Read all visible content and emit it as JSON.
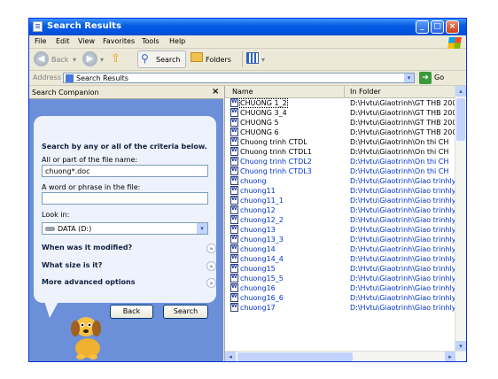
{
  "window": {
    "title": "Search Results"
  },
  "menu": [
    "File",
    "Edit",
    "View",
    "Favorites",
    "Tools",
    "Help"
  ],
  "toolbar": {
    "back_label": "Back",
    "search_label": "Search",
    "folders_label": "Folders"
  },
  "address": {
    "label": "Address",
    "value": "Search Results",
    "go_label": "Go"
  },
  "companion": {
    "title": "Search Companion",
    "close_glyph": "×",
    "heading": "Search by any or all of the criteria below.",
    "name_label": "All or part of the file name:",
    "name_value": "chuong*.doc",
    "phrase_label": "A word or phrase in the file:",
    "phrase_value": "",
    "lookin_label": "Look in:",
    "lookin_value": "DATA (D:)",
    "modified_label": "When was it modified?",
    "size_label": "What size is it?",
    "advanced_label": "More advanced options",
    "back_button": "Back",
    "search_button": "Search"
  },
  "results": {
    "columns": {
      "name": "Name",
      "folder": "In Folder"
    },
    "rows": [
      {
        "name": "CHUONG 1_2",
        "folder": "D:\\Hvtu\\Giaotrinh\\GT THB 2004"
      },
      {
        "name": "CHUONG 3_4",
        "folder": "D:\\Hvtu\\Giaotrinh\\GT THB 2004"
      },
      {
        "name": "CHUONG 5",
        "folder": "D:\\Hvtu\\Giaotrinh\\GT THB 2004"
      },
      {
        "name": "CHUONG 6",
        "folder": "D:\\Hvtu\\Giaotrinh\\GT THB 2004"
      },
      {
        "name": "Chuong trinh CTDL",
        "folder": "D:\\Hvtu\\Giaotrinh\\On thi CH"
      },
      {
        "name": "Chuong trinh CTDL1",
        "folder": "D:\\Hvtu\\Giaotrinh\\On thi CH"
      },
      {
        "name": "Chuong trinh CTDL2",
        "folder": "D:\\Hvtu\\Giaotrinh\\On thi CH"
      },
      {
        "name": "Chuong trinh CTDL3",
        "folder": "D:\\Hvtu\\Giaotrinh\\On thi CH"
      },
      {
        "name": "chuong",
        "folder": "D:\\Hvtu\\Giaotrinh\\Giao trinhlyth..."
      },
      {
        "name": "chuong11",
        "folder": "D:\\Hvtu\\Giaotrinh\\Giao trinhlyth..."
      },
      {
        "name": "chuong11_1",
        "folder": "D:\\Hvtu\\Giaotrinh\\Giao trinhlyth..."
      },
      {
        "name": "chuong12",
        "folder": "D:\\Hvtu\\Giaotrinh\\Giao trinhlyth..."
      },
      {
        "name": "chuong12_2",
        "folder": "D:\\Hvtu\\Giaotrinh\\Giao trinhlyth..."
      },
      {
        "name": "chuong13",
        "folder": "D:\\Hvtu\\Giaotrinh\\Giao trinhlyth..."
      },
      {
        "name": "chuong13_3",
        "folder": "D:\\Hvtu\\Giaotrinh\\Giao trinhlyth..."
      },
      {
        "name": "chuong14",
        "folder": "D:\\Hvtu\\Giaotrinh\\Giao trinhlyth..."
      },
      {
        "name": "chuong14_4",
        "folder": "D:\\Hvtu\\Giaotrinh\\Giao trinhlyth..."
      },
      {
        "name": "chuong15",
        "folder": "D:\\Hvtu\\Giaotrinh\\Giao trinhlyth..."
      },
      {
        "name": "chuong15_5",
        "folder": "D:\\Hvtu\\Giaotrinh\\Giao trinhlyth..."
      },
      {
        "name": "chuong16",
        "folder": "D:\\Hvtu\\Giaotrinh\\Giao trinhlyth..."
      },
      {
        "name": "chuong16_6",
        "folder": "D:\\Hvtu\\Giaotrinh\\Giao trinhlyth..."
      },
      {
        "name": "chuong17",
        "folder": "D:\\Hvtu\\Giaotrinh\\Giao trinhlyth..."
      }
    ]
  },
  "colors": {
    "titlebar": "#0054e3",
    "panel": "#6b8fd8",
    "link": "#0033cc"
  }
}
